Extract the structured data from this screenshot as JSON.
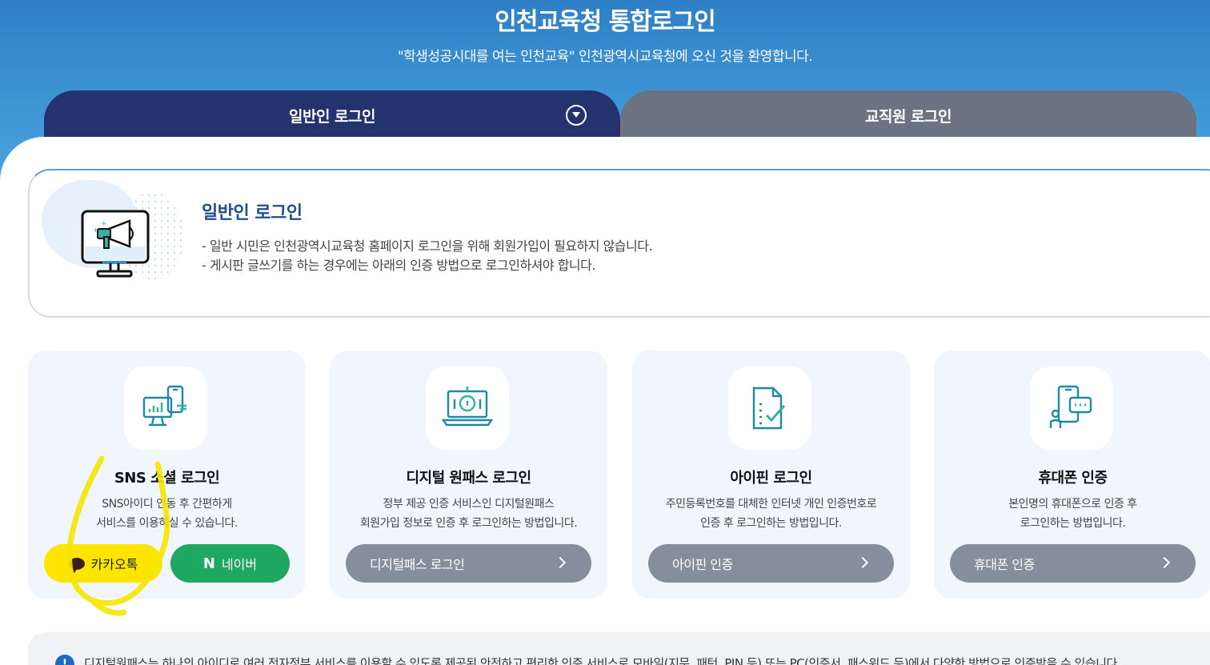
{
  "hero": {
    "title": "인천교육청 통합로그인",
    "subtitle": "\"학생성공시대를 여는 인천교육\" 인천광역시교육청에 오신 것을 환영합니다."
  },
  "tabs": [
    {
      "label": "일반인 로그인",
      "active": true
    },
    {
      "label": "교직원 로그인",
      "active": false
    }
  ],
  "info": {
    "title": "일반인 로그인",
    "lines": [
      "- 일반 시민은 인천광역시교육청 홈페이지 로그인을 위해 회원가입이 필요하지 않습니다.",
      "- 게시판 글쓰기를 하는 경우에는 아래의 인증 방법으로 로그인하셔야 합니다."
    ]
  },
  "cards": [
    {
      "title": "SNS 소셜 로그인",
      "desc": [
        "SNS아이디 연동 후 간편하게",
        "서비스를 이용하실 수 있습니다."
      ],
      "kakao_label": "카카오톡",
      "naver_label": "네이버",
      "naver_logo": "N"
    },
    {
      "title": "디지털 원패스 로그인",
      "desc": [
        "정부 제공 인증 서비스인 디지털원패스",
        "회원가입 정보로 인증 후 로그인하는 방법입니다."
      ],
      "button": "디지털패스 로그인"
    },
    {
      "title": "아이핀 로그인",
      "desc": [
        "주민등록번호를 대체한 인터넷 개인 인증번호로",
        "인증 후 로그인하는 방법입니다."
      ],
      "button": "아이핀 인증"
    },
    {
      "title": "휴대폰 인증",
      "desc": [
        "본인명의 휴대폰으로 인증 후",
        "로그인하는 방법입니다."
      ],
      "button": "휴대폰 인증"
    }
  ],
  "notice": {
    "icon": "!",
    "text": "디지털원패스는 하나의 아이디로 여러 전자정부 서비스를 이용할 수 있도록 제공된 안전하고 편리한 인증 서비스로 모바일(지문, 패턴, PIN 등) 또는 PC(인증서, 패스워드 등)에서 다양한 방법으로 인증받을 수 있습니다."
  },
  "colors": {
    "hero": "#3d8fd0",
    "tab_active": "#253270",
    "tab_inactive": "#6b7282",
    "kakao": "#fee500",
    "naver": "#1ea862",
    "card_button": "#858e9c",
    "annotation": "#f5e600"
  }
}
